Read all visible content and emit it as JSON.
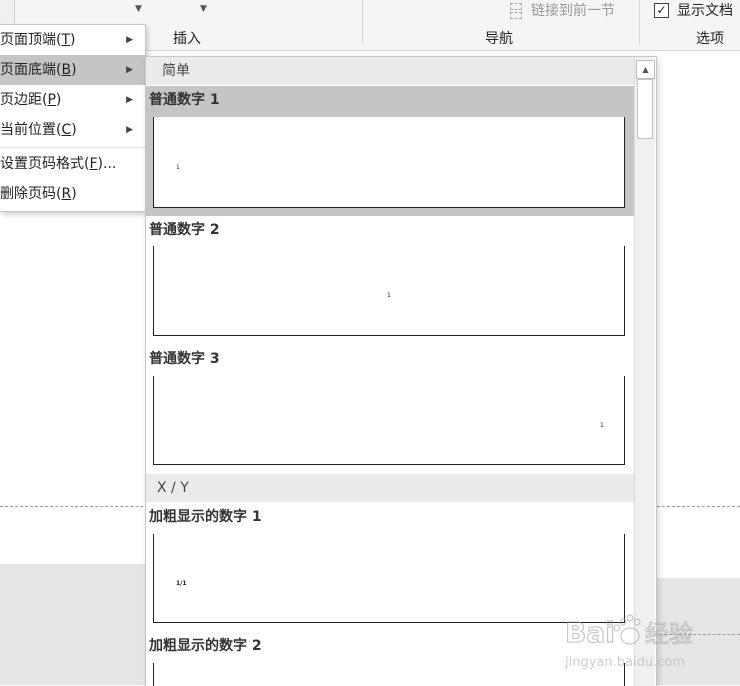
{
  "ribbon": {
    "groups": {
      "insert": "插入",
      "navigation": "导航",
      "options": "选项"
    },
    "link_to_previous": "链接到前一节",
    "show_document": "显示文档",
    "show_document_checked": true
  },
  "menu": {
    "items": [
      {
        "label": "页面顶端(",
        "key": "T",
        "tail": ")",
        "has_submenu": true
      },
      {
        "label": "页面底端(",
        "key": "B",
        "tail": ")",
        "has_submenu": true,
        "active": true
      },
      {
        "label": "页边距(",
        "key": "P",
        "tail": ")",
        "has_submenu": true
      },
      {
        "label": "当前位置(",
        "key": "C",
        "tail": ")",
        "has_submenu": true
      },
      {
        "label": "设置页码格式(",
        "key": "F",
        "tail": ")...",
        "has_submenu": false
      },
      {
        "label": "删除页码(",
        "key": "R",
        "tail": ")",
        "has_submenu": false
      }
    ]
  },
  "gallery": {
    "categories": [
      "简单",
      "X / Y"
    ],
    "entries": [
      {
        "label": "普通数字 1",
        "page_number": "1"
      },
      {
        "label": "普通数字 2",
        "page_number": "1"
      },
      {
        "label": "普通数字 3",
        "page_number": "1"
      },
      {
        "label": "加粗显示的数字 1",
        "page_number": "1/1"
      },
      {
        "label": "加粗显示的数字 2",
        "page_number": ""
      }
    ]
  },
  "watermark": {
    "brand": "Bai",
    "brand_tail": "经验",
    "url": "jingyan.baidu.com"
  },
  "colors": {
    "ribbon_bg": "#f5f5f5",
    "selected_bg": "#c5c5c5",
    "category_bg": "#ebebeb"
  }
}
